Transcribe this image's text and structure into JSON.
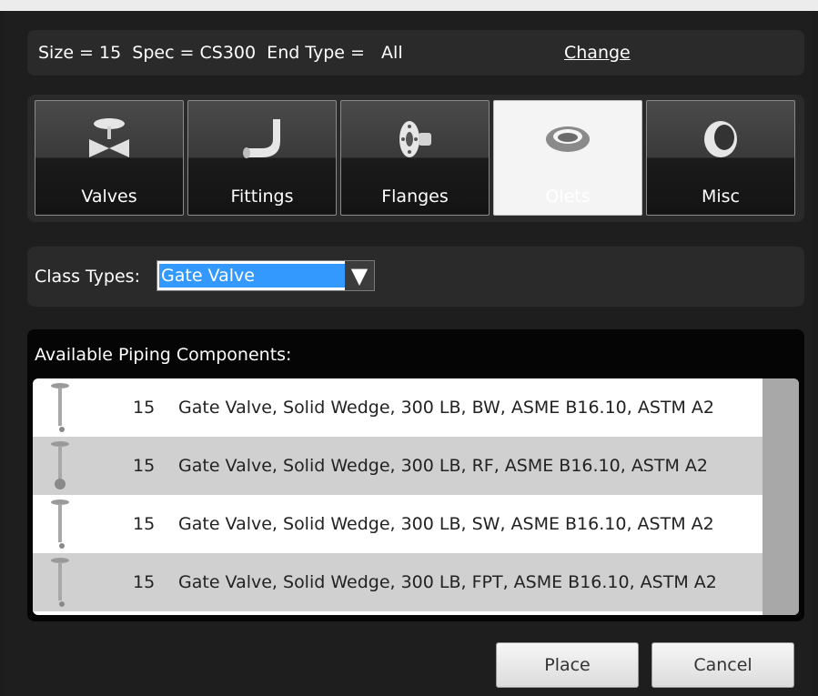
{
  "info_bar": {
    "text": "Size = 15  Spec = CS300  End Type =   All",
    "change_label": "Change"
  },
  "categories": [
    {
      "label": "Valves",
      "icon": "valve-icon"
    },
    {
      "label": "Fittings",
      "icon": "elbow-fitting-icon"
    },
    {
      "label": "Flanges",
      "icon": "flange-icon"
    },
    {
      "label": "Olets",
      "icon": "olet-icon",
      "selected": true
    },
    {
      "label": "Misc",
      "icon": "misc-pipe-end-icon"
    }
  ],
  "class_types": {
    "label": "Class Types:",
    "selected": "Gate Valve"
  },
  "components": {
    "header": "Available Piping Components:",
    "rows": [
      {
        "size": "15",
        "desc": "Gate Valve, Solid Wedge, 300 LB, BW, ASME B16.10, ASTM A2"
      },
      {
        "size": "15",
        "desc": "Gate Valve, Solid Wedge, 300 LB, RF, ASME B16.10, ASTM A2"
      },
      {
        "size": "15",
        "desc": "Gate Valve, Solid Wedge, 300 LB, SW, ASME B16.10, ASTM A2"
      },
      {
        "size": "15",
        "desc": "Gate Valve, Solid Wedge, 300 LB, FPT, ASME B16.10, ASTM A2"
      }
    ]
  },
  "buttons": {
    "place": "Place",
    "cancel": "Cancel"
  },
  "colors": {
    "panel_bg": "#1e1e1e",
    "selection_blue": "#3399ff",
    "selected_tile": "#f4f4f4"
  }
}
